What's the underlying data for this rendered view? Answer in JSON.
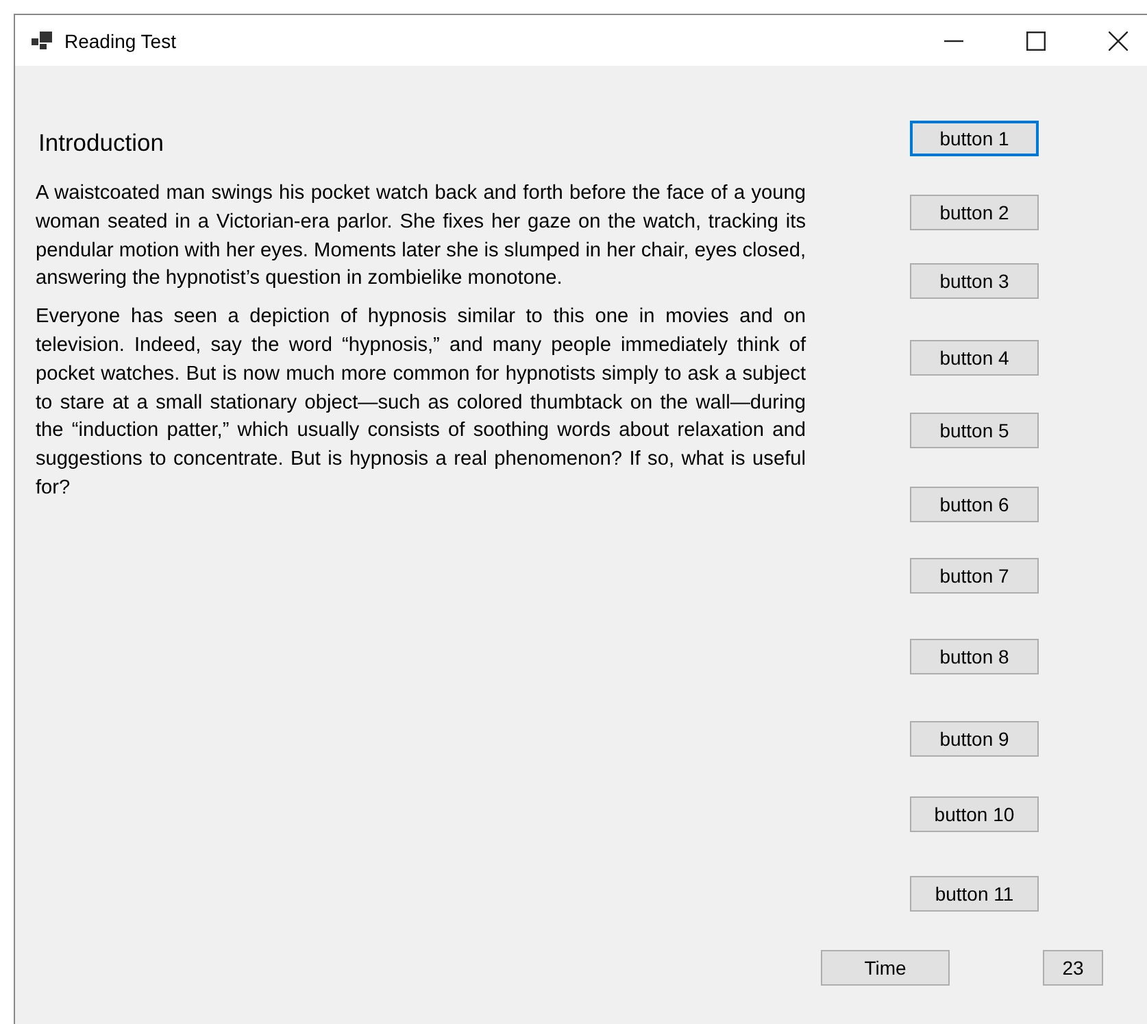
{
  "window": {
    "title": "Reading Test"
  },
  "heading": "Introduction",
  "paragraphs": [
    "A waistcoated man swings his pocket watch back and forth before the face of a young woman seated in a Victorian-era parlor. She fixes her gaze on the watch, tracking its pendular motion with her eyes. Moments later she is slumped in her chair, eyes closed, answering the hypnotist’s question in zombielike monotone.",
    "Everyone has seen a depiction of hypnosis similar to this one in movies and on television. Indeed, say the word “hypnosis,” and many people immediately think of pocket watches. But is now much more common for hypnotists simply to ask a subject to stare at a small stationary object—such as colored thumbtack on the wall—during the “induction patter,” which usually consists of soothing words about relaxation and suggestions to concentrate. But is hypnosis a real phenomenon? If so, what is useful for?"
  ],
  "buttons": [
    {
      "label": "button 1",
      "focused": true
    },
    {
      "label": "button 2",
      "focused": false
    },
    {
      "label": "button 3",
      "focused": false
    },
    {
      "label": "button 4",
      "focused": false
    },
    {
      "label": "button 5",
      "focused": false
    },
    {
      "label": "button 6",
      "focused": false
    },
    {
      "label": "button 7",
      "focused": false
    },
    {
      "label": "button 8",
      "focused": false
    },
    {
      "label": "button 9",
      "focused": false
    },
    {
      "label": "button 10",
      "focused": false
    },
    {
      "label": "button 11",
      "focused": false
    }
  ],
  "time_button": "Time",
  "time_value": "23"
}
